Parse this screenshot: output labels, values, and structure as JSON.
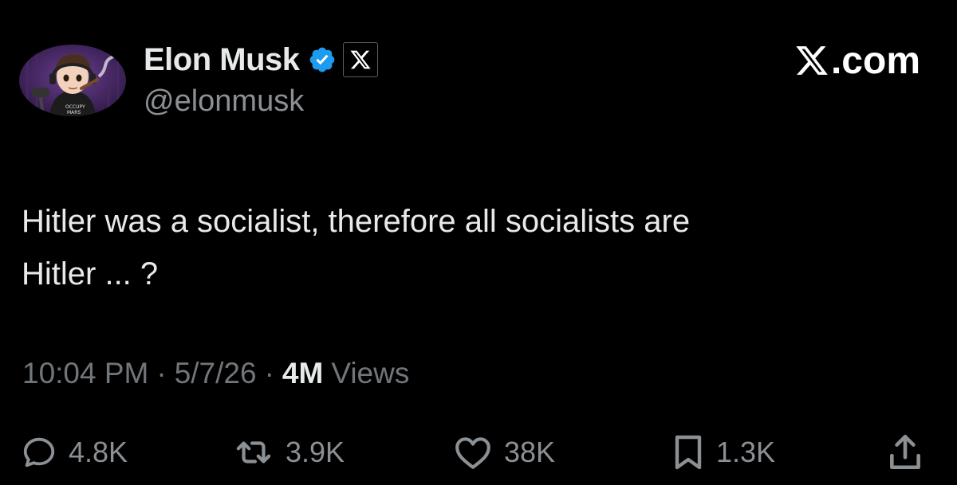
{
  "author": {
    "name": "Elon Musk",
    "handle": "@elonmusk",
    "verified_icon": "verified-badge-icon",
    "affiliation_icon": "x-logo-icon"
  },
  "brand": {
    "label": ".com",
    "icon": "x-logo-icon"
  },
  "tweet": {
    "text": "Hitler was a socialist, therefore all socialists are\nHitler ... ?"
  },
  "meta": {
    "time": "10:04 PM",
    "separator": "·",
    "date": "5/7/26",
    "views_count": "4M",
    "views_label": "Views"
  },
  "actions": {
    "replies": "4.8K",
    "reposts": "3.9K",
    "likes": "38K",
    "bookmarks": "1.3K"
  },
  "colors": {
    "background": "#000000",
    "text_primary": "#e7e9ea",
    "text_secondary": "#71767b",
    "verified": "#1d9bf0"
  }
}
